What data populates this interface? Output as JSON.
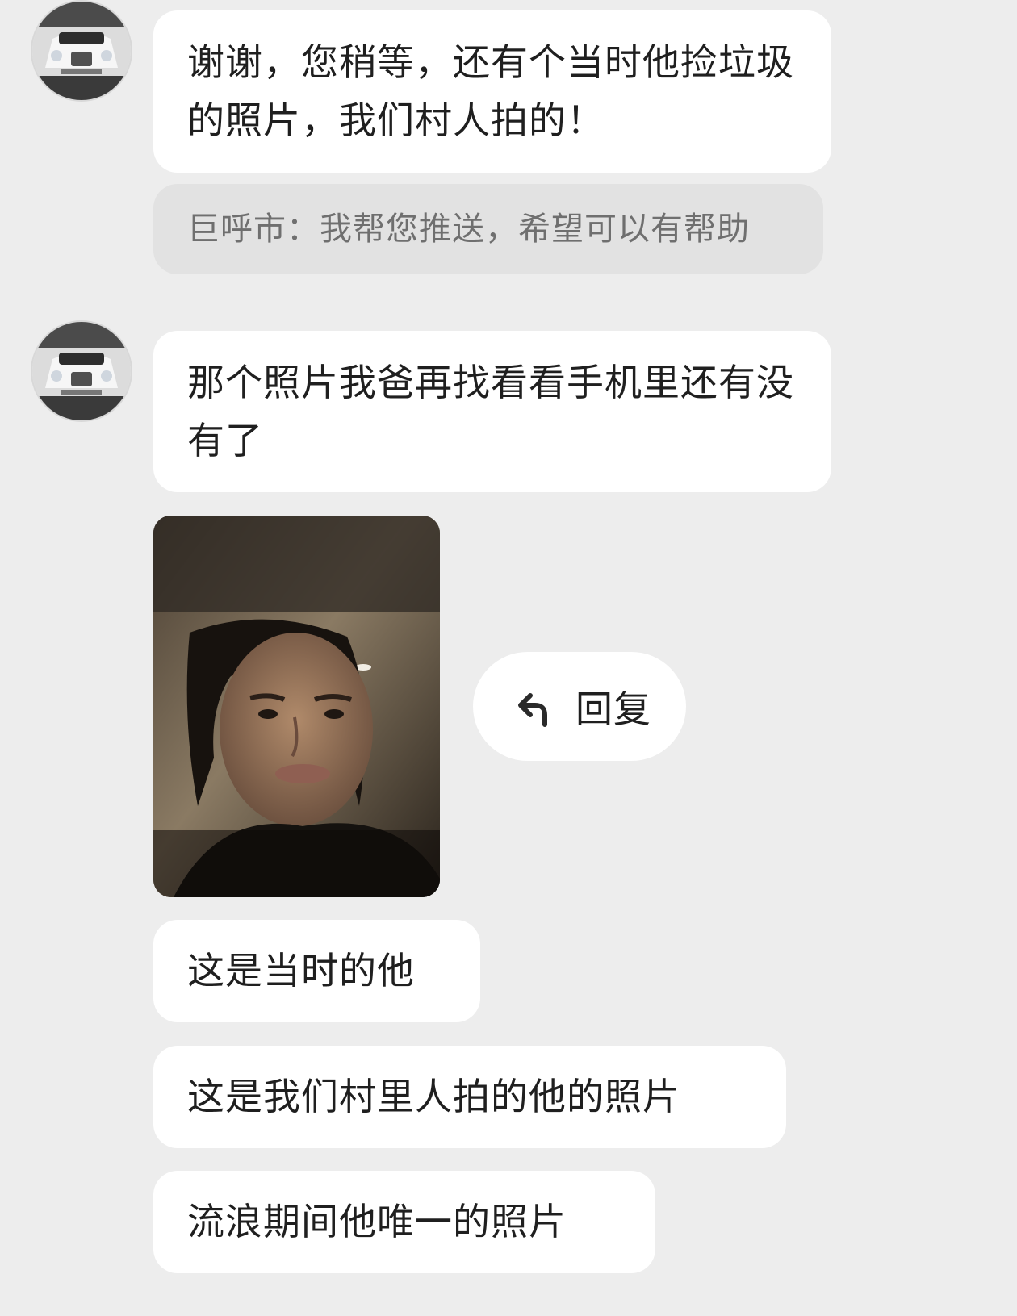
{
  "messages": [
    {
      "id": "m1",
      "sender": "contact",
      "text": "谢谢，您稍等，还有个当时他捡垃圾的照片，我们村人拍的！"
    },
    {
      "id": "m2",
      "sender": "system",
      "text": "巨呼市：我帮您推送，希望可以有帮助"
    },
    {
      "id": "m3",
      "sender": "contact",
      "text": "那个照片我爸再找看看手机里还有没有了"
    },
    {
      "id": "m4",
      "sender": "contact",
      "type": "image"
    },
    {
      "id": "m5",
      "sender": "contact",
      "text": "这是当时的他"
    },
    {
      "id": "m6",
      "sender": "contact",
      "text": "这是我们村里人拍的他的照片"
    },
    {
      "id": "m7",
      "sender": "contact",
      "text": "流浪期间他唯一的照片"
    }
  ],
  "reply_button": {
    "label": "回复",
    "icon": "reply-arrow-icon"
  },
  "colors": {
    "background": "#ededed",
    "bubble": "#ffffff",
    "system_bubble": "#e2e2e2",
    "text": "#1f1f1f",
    "system_text": "#6f6f6f"
  }
}
